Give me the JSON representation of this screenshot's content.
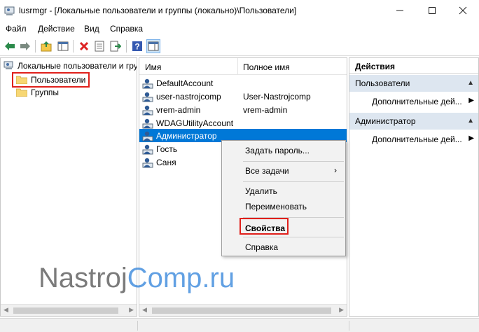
{
  "window": {
    "title": "lusrmgr - [Локальные пользователи и группы (локально)\\Пользователи]",
    "minimize": "—",
    "maximize": "☐",
    "close": "✕"
  },
  "menu": [
    "Файл",
    "Действие",
    "Вид",
    "Справка"
  ],
  "tree": {
    "root": "Локальные пользователи и гру",
    "users": "Пользователи",
    "groups": "Группы"
  },
  "list": {
    "headers": {
      "name": "Имя",
      "full_name": "Полное имя"
    },
    "rows": [
      {
        "name": "DefaultAccount",
        "full_name": ""
      },
      {
        "name": "user-nastrojcomp",
        "full_name": "User-Nastrojcomp"
      },
      {
        "name": "vrem-admin",
        "full_name": "vrem-admin"
      },
      {
        "name": "WDAGUtilityAccount",
        "full_name": ""
      },
      {
        "name": "Администратор",
        "full_name": ""
      },
      {
        "name": "Гость",
        "full_name": ""
      },
      {
        "name": "Саня",
        "full_name": ""
      }
    ],
    "selected_index": 4
  },
  "context_menu": {
    "set_password": "Задать пароль...",
    "all_tasks": "Все задачи",
    "delete": "Удалить",
    "rename": "Переименовать",
    "properties": "Свойства",
    "help": "Справка"
  },
  "actions": {
    "title": "Действия",
    "section1": "Пользователи",
    "section1_more": "Дополнительные дей...",
    "section2": "Администратор",
    "section2_more": "Дополнительные дей..."
  },
  "watermark": {
    "part1": "Nastroj",
    "part2": "Comp.ru"
  },
  "colors": {
    "selection": "#0078d7",
    "highlight_box": "#e0201b",
    "actions_section": "#dde6f0"
  }
}
